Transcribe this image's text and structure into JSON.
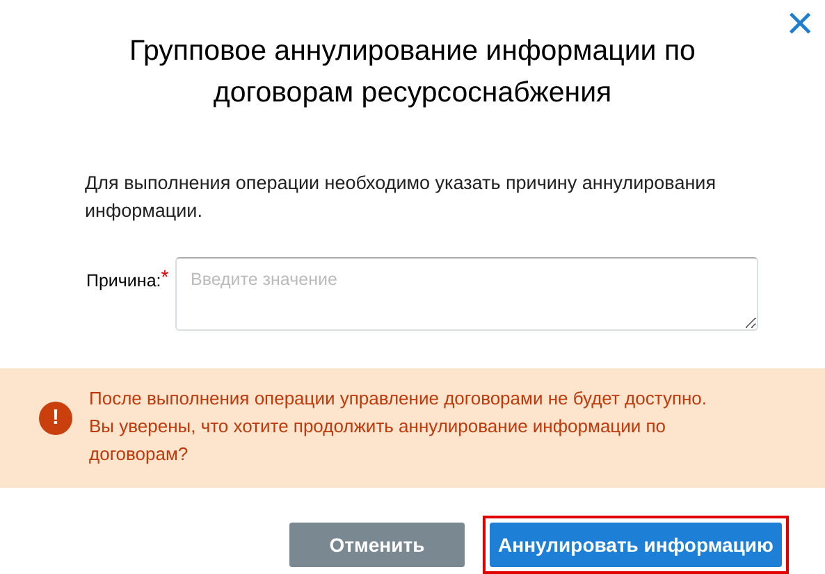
{
  "dialog": {
    "title": "Групповое аннулирование информации по договорам ресурсоснабжения",
    "close": "×"
  },
  "description": "Для выполнения операции необходимо указать причину аннулирования информации.",
  "field": {
    "label": "Причина:",
    "required_mark": "*",
    "placeholder": "Введите значение"
  },
  "warning": {
    "icon": "!",
    "lines": [
      "После выполнения операции управление договорами не будет доступно.",
      "Вы уверены, что хотите продолжить аннулирование информации по договорам?"
    ]
  },
  "buttons": [
    {
      "label": "Отменить",
      "kind": "secondary",
      "highlighted": false
    },
    {
      "label": "Аннулировать информацию",
      "kind": "primary",
      "highlighted": true
    }
  ]
}
